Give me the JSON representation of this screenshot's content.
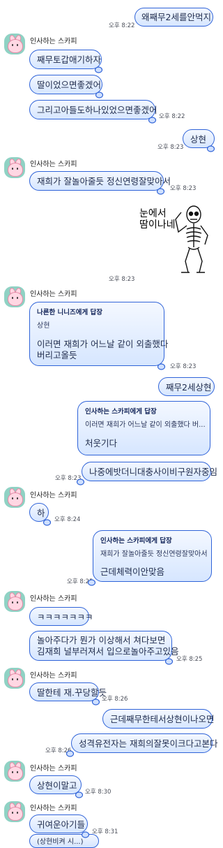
{
  "messages": {
    "m1": {
      "text": "왜째무2세를안먹지",
      "time": "오후 8:22"
    },
    "g1": {
      "name": "인사하는 스카피"
    },
    "m2": {
      "text": "째무토갑애기하자"
    },
    "m3": {
      "text": "딸이었으면좋겠어"
    },
    "m4": {
      "text": "그리고아들도하나있었으면좋겠어",
      "time": "오후 8:22"
    },
    "m5": {
      "text": "상현",
      "time": "오후 8:23"
    },
    "g2": {
      "name": "인사하는 스카피"
    },
    "m6": {
      "text": "재희가 잘놀아줄듯 정신연령잘맞아서",
      "time": "오후 8:23"
    },
    "sticker": {
      "line1": "눈에서",
      "line2": "땀이나네",
      "time": "오후 8:23"
    },
    "g3": {
      "name": "인사하는 스카피"
    },
    "m7": {
      "reply_title": "나른한 니니즈에게 답장",
      "reply_quote": "상현",
      "line1": "이러면 재희가 어느날 같이 외출했다",
      "line2": "버리고올듯",
      "time": "오후 8:23"
    },
    "m8": {
      "text": "째무2세상현"
    },
    "m9": {
      "reply_title": "인사하는 스카피에게 답장",
      "reply_quote": "이러면 재희가 어느날 같이 외출했다 버...",
      "text": "처웃기다"
    },
    "m10": {
      "text": "나중에밧더니대충사이비구원자중임",
      "time": "오후 8:23"
    },
    "g4": {
      "name": "인사하는 스카피"
    },
    "m11": {
      "text": "하",
      "time": "오후 8:24"
    },
    "m12": {
      "reply_title": "인사하는 스카피에게 답장",
      "reply_quote": "재희가 잘놀아줄듯 정신연령잘맞아서",
      "text": "근데체력이안맞음",
      "time": "오후 8:25"
    },
    "g5": {
      "name": "인사하는 스카피"
    },
    "m13": {
      "text": "ㅋㅋㅋㅋㅋㅋㅋ"
    },
    "m14": {
      "line1": "놀아주다가 뭔가 이상해서 쳐다보면",
      "line2": "김재희 널부러져서 입으로놀아주고있음",
      "time": "오후 8:25"
    },
    "g6": {
      "name": "인사하는 스카피"
    },
    "m15": {
      "text": "딸한테 재.꾸당할듯",
      "time": "오후 8:26"
    },
    "m16": {
      "text": "근데째무한테서상현이나오면"
    },
    "m17": {
      "text": "성격유전자는 재희의잘못이크다고본다",
      "time": "오후 8:26"
    },
    "g7": {
      "name": "인사하는 스카피"
    },
    "m18": {
      "text": "상현이말고",
      "time": "오후 8:30"
    },
    "g8": {
      "name": "인사하는 스카피"
    },
    "m19": {
      "text": "귀여운아기들",
      "time": "오후 8:31"
    },
    "m20": {
      "text": "(상현비켜 시...)"
    }
  },
  "colors": {
    "bubble_border": "#2f63d8",
    "bubble_fill": "#d6e6ff",
    "avatar_bg": "#8fd2c4"
  },
  "icons": [
    "cloud-tail-icon",
    "skeleton-sticker",
    "scoopy-avatar"
  ]
}
